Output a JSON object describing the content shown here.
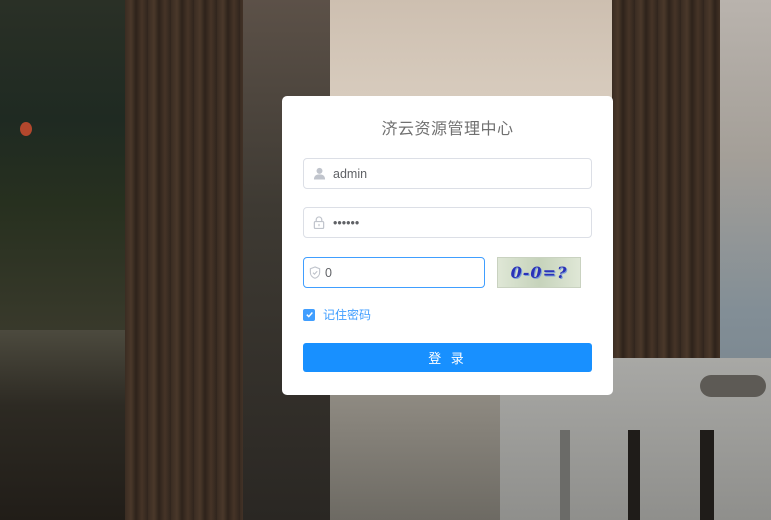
{
  "login": {
    "title": "济云资源管理中心",
    "username": {
      "value": "admin",
      "icon": "user-icon"
    },
    "password": {
      "value": "••••••",
      "icon": "lock-icon"
    },
    "captcha_input": {
      "value": "0",
      "icon": "shield-icon"
    },
    "captcha_image_text": "0-0=?",
    "remember": {
      "label": "记住密码",
      "checked": true
    },
    "submit_label": "登 录"
  },
  "colors": {
    "primary": "#1890ff",
    "link": "#409eff",
    "card": "#ffffff",
    "title_text": "#707070"
  }
}
